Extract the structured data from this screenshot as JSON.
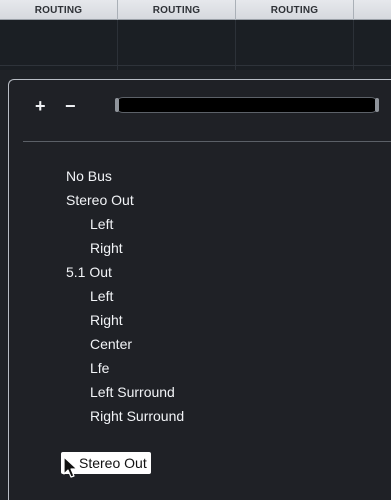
{
  "header": {
    "columns": [
      "ROUTING",
      "ROUTING",
      "ROUTING"
    ]
  },
  "popup": {
    "plus_label": "+",
    "minus_label": "−",
    "search_placeholder": "",
    "items": [
      {
        "label": "No Bus",
        "level": 1
      },
      {
        "label": "Stereo Out",
        "level": 1
      },
      {
        "label": "Left",
        "level": 2
      },
      {
        "label": "Right",
        "level": 2
      },
      {
        "label": "5.1 Out",
        "level": 1
      },
      {
        "label": "Left",
        "level": 2
      },
      {
        "label": "Right",
        "level": 2
      },
      {
        "label": "Center",
        "level": 2
      },
      {
        "label": "Lfe",
        "level": 2
      },
      {
        "label": "Left Surround",
        "level": 2
      },
      {
        "label": "Right Surround",
        "level": 2
      }
    ]
  },
  "drag": {
    "label": "Stereo Out",
    "icon": "arrow-cursor-icon"
  },
  "colors": {
    "background": "#1f2227",
    "header": "#e6e8ec",
    "popup": "#1f2126",
    "text": "#f2f4f7",
    "search": "#000000"
  }
}
